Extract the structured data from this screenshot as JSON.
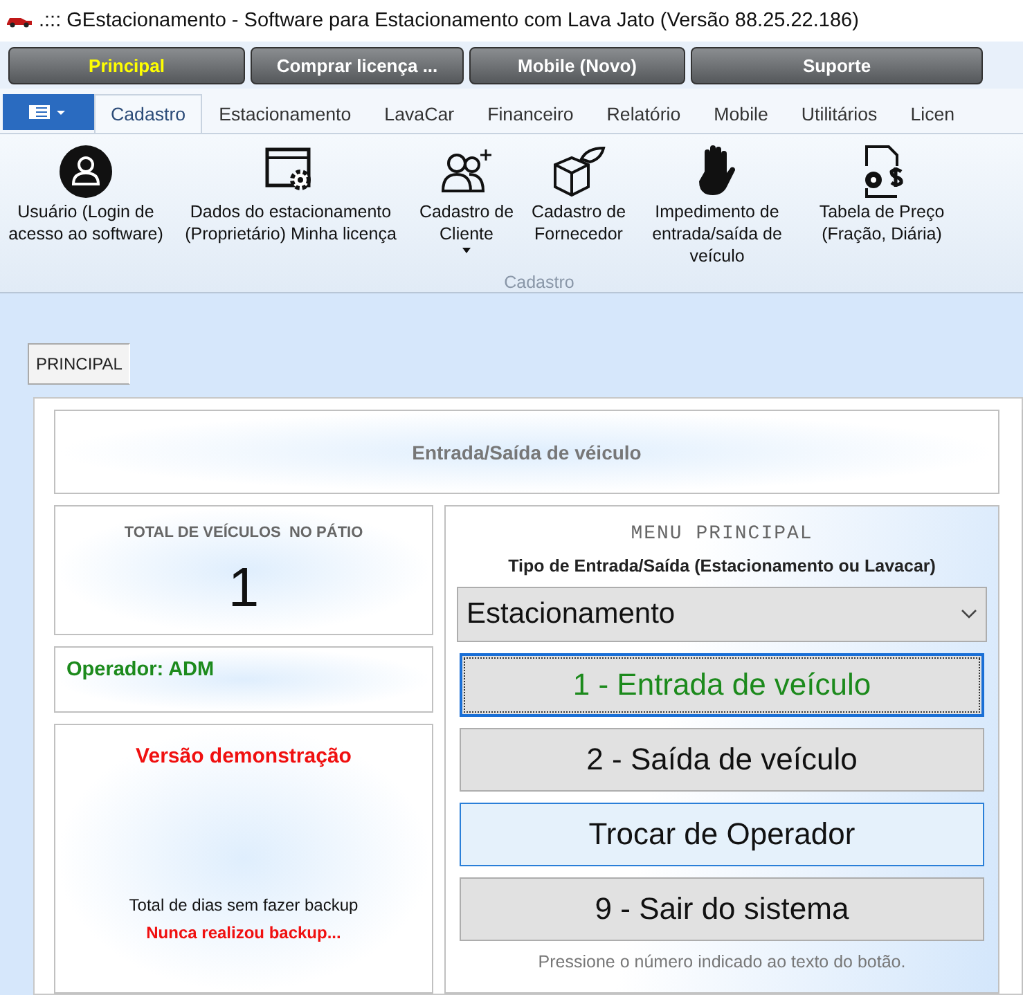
{
  "window": {
    "title": ".::: GEstacionamento - Software para Estacionamento com Lava Jato (Versão 88.25.22.186)"
  },
  "top_buttons": [
    {
      "label": "Principal",
      "selected": true
    },
    {
      "label": "Comprar licença ...",
      "selected": false
    },
    {
      "label": "Mobile (Novo)",
      "selected": false
    },
    {
      "label": "Suporte",
      "selected": false
    }
  ],
  "ribbon_tabs": [
    {
      "label": "Cadastro",
      "selected": true
    },
    {
      "label": "Estacionamento",
      "selected": false
    },
    {
      "label": "LavaCar",
      "selected": false
    },
    {
      "label": "Financeiro",
      "selected": false
    },
    {
      "label": "Relatório",
      "selected": false
    },
    {
      "label": "Mobile",
      "selected": false
    },
    {
      "label": "Utilitários",
      "selected": false
    },
    {
      "label": "Licen",
      "selected": false
    }
  ],
  "ribbon_group": {
    "label": "Cadastro",
    "items": [
      {
        "kind": "user",
        "label": "Usuário (Login de acesso ao software)",
        "dropdown": false
      },
      {
        "kind": "settings",
        "label": "Dados do estacionamento (Proprietário) Minha licença",
        "dropdown": false
      },
      {
        "kind": "people",
        "label": "Cadastro de Cliente",
        "dropdown": true
      },
      {
        "kind": "box",
        "label": "Cadastro de Fornecedor",
        "dropdown": false
      },
      {
        "kind": "hand",
        "label": "Impedimento de entrada/saída de veículo",
        "dropdown": false
      },
      {
        "kind": "price",
        "label": "Tabela de Preço (Fração, Diária)",
        "dropdown": false
      }
    ]
  },
  "page_tabs": [
    {
      "label": "PRINCIPAL",
      "selected": true
    }
  ],
  "header": {
    "title": "Entrada/Saída de véiculo"
  },
  "vehicles_panel": {
    "label": "TOTAL DE VEÍCULOS  NO PÁTIO",
    "count": "1"
  },
  "operator": {
    "text": "Operador: ADM"
  },
  "demo_panel": {
    "version": "Versão demonstração",
    "backup_label": "Total de dias sem fazer backup",
    "backup_status": "Nunca realizou backup..."
  },
  "menu": {
    "title": "MENU PRINCIPAL",
    "type_label": "Tipo de Entrada/Saída (Estacionamento ou Lavacar)",
    "type_value": "Estacionamento",
    "buttons": [
      {
        "label": "1 - Entrada de veículo",
        "focused": true,
        "hovered": false
      },
      {
        "label": "2 - Saída de veículo",
        "focused": false,
        "hovered": false
      },
      {
        "label": "Trocar de Operador",
        "focused": false,
        "hovered": true
      },
      {
        "label": "9 - Sair do sistema",
        "focused": false,
        "hovered": false
      }
    ],
    "hint": "Pressione o número indicado ao texto do botão."
  }
}
